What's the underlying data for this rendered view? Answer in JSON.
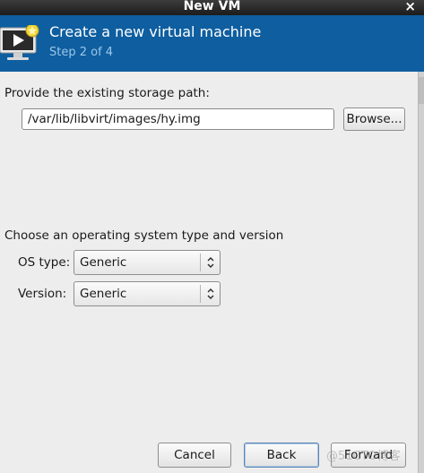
{
  "window": {
    "title": "New VM",
    "close_glyph": "×"
  },
  "header": {
    "title": "Create a new virtual machine",
    "step": "Step 2 of 4",
    "icon": "vm-monitor-icon"
  },
  "storage": {
    "label": "Provide the existing storage path:",
    "path_value": "/var/lib/libvirt/images/hy.img",
    "browse_label": "Browse..."
  },
  "os": {
    "section_label": "Choose an operating system type and version",
    "type_label": "OS type:",
    "type_value": "Generic",
    "version_label": "Version:",
    "version_value": "Generic"
  },
  "footer": {
    "cancel_label": "Cancel",
    "back_label": "Back",
    "forward_label": "Forward"
  },
  "watermark": "@51CTO博客",
  "colors": {
    "header_bg": "#0e5ea0",
    "step_text": "#9cc7e8",
    "window_bg": "#ededed"
  }
}
